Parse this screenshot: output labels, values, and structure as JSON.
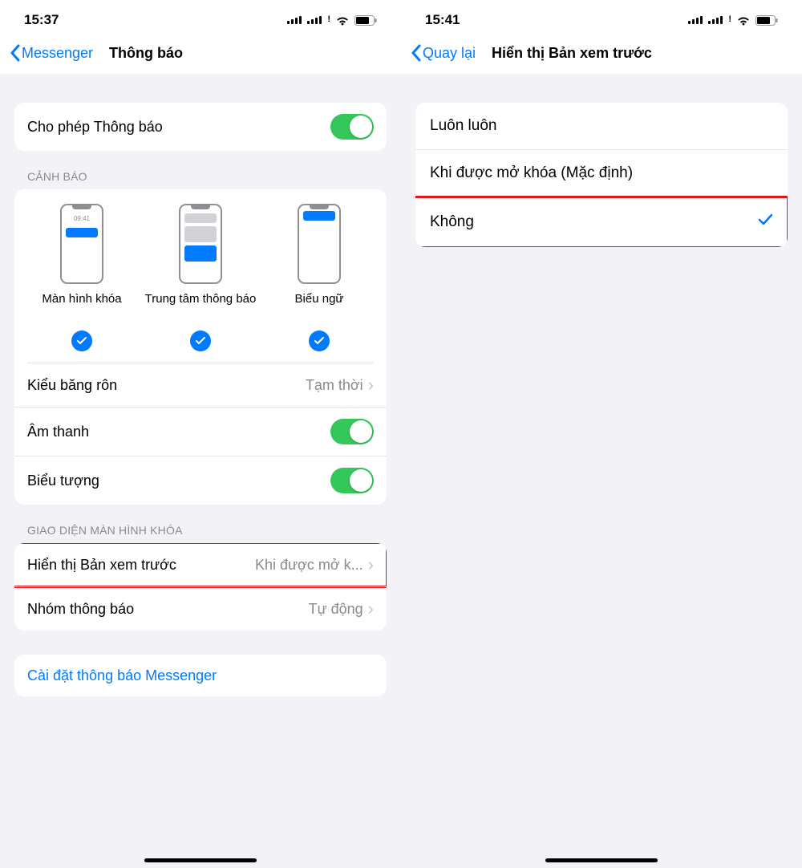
{
  "left": {
    "status": {
      "time": "15:37"
    },
    "nav": {
      "back": "Messenger",
      "title": "Thông báo"
    },
    "allow": {
      "label": "Cho phép Thông báo"
    },
    "alertsHeader": "CẢNH BÁO",
    "alerts": {
      "lockTime": "09:41",
      "lock": "Màn hình khóa",
      "center": "Trung tâm thông báo",
      "banner": "Biểu ngữ"
    },
    "bannerStyle": {
      "label": "Kiểu băng rôn",
      "value": "Tạm thời"
    },
    "sound": {
      "label": "Âm thanh"
    },
    "badge": {
      "label": "Biểu tượng"
    },
    "lockHeader": "GIAO DIỆN MÀN HÌNH KHÓA",
    "preview": {
      "label": "Hiển thị Bản xem trước",
      "value": "Khi được mở k..."
    },
    "grouping": {
      "label": "Nhóm thông báo",
      "value": "Tự động"
    },
    "footerLink": "Cài đặt thông báo Messenger"
  },
  "right": {
    "status": {
      "time": "15:41"
    },
    "nav": {
      "back": "Quay lại",
      "title": "Hiển thị Bản xem trước"
    },
    "options": {
      "always": "Luôn luôn",
      "unlocked": "Khi được mở khóa (Mặc định)",
      "never": "Không"
    }
  }
}
